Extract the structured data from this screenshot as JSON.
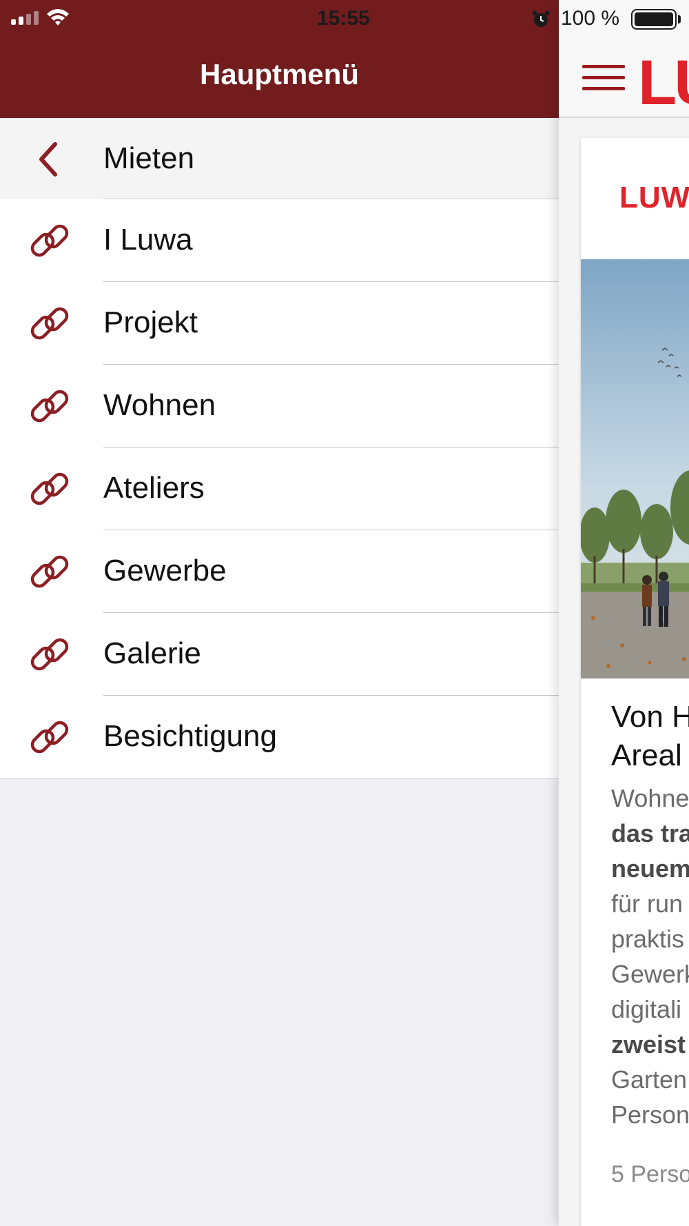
{
  "status_bar": {
    "time": "15:55",
    "battery_text": "100 %"
  },
  "menu": {
    "title": "Hauptmenü",
    "back_item": {
      "label": "Mieten",
      "icon": "chevron-left-icon"
    },
    "items": [
      {
        "label": "I Luwa",
        "icon": "link-icon"
      },
      {
        "label": "Projekt",
        "icon": "link-icon"
      },
      {
        "label": "Wohnen",
        "icon": "link-icon"
      },
      {
        "label": "Ateliers",
        "icon": "link-icon"
      },
      {
        "label": "Gewerbe",
        "icon": "link-icon"
      },
      {
        "label": "Galerie",
        "icon": "link-icon"
      },
      {
        "label": "Besichtigung",
        "icon": "link-icon"
      }
    ]
  },
  "content": {
    "nav_logo": "LU",
    "card_logo": "LUWA",
    "card_title": [
      "Von H",
      "Areal"
    ],
    "card_text_lines": [
      {
        "text": "Wohne",
        "bold": false
      },
      {
        "text": "das tra",
        "bold": true
      },
      {
        "text": "neuem",
        "bold": true
      },
      {
        "text": "für run",
        "bold": false
      },
      {
        "text": "praktis",
        "bold": false
      },
      {
        "text": "Gewerk",
        "bold": false
      },
      {
        "text": "digitali",
        "bold": false
      },
      {
        "text": "zweist",
        "bold": true
      },
      {
        "text": "Garten",
        "bold": false
      },
      {
        "text": "Person",
        "bold": false
      }
    ],
    "card_footer": "5 Perso"
  },
  "colors": {
    "header_bg": "#721c1e",
    "accent": "#8b1f24",
    "logo_red": "#e0232a",
    "panel_bg": "#efeff4"
  }
}
